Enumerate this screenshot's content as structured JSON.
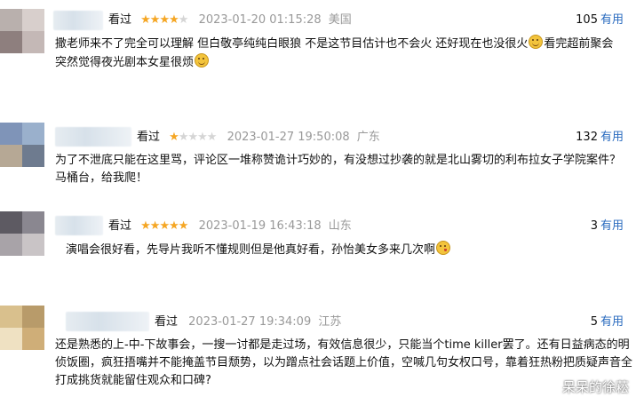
{
  "comments": [
    {
      "seen_label": "看过",
      "rating": 4,
      "time": "2023-01-20 01:15:28",
      "location": "美国",
      "votes": "105",
      "useful_label": "有用",
      "text_parts": [
        "撒老师来不了完全可以理解 但白敬亭纯纯白眼狼 不是这节目估计也不会火 还好现在也没很火",
        "看完超前聚会突然觉得夜光剧本女星很烦"
      ]
    },
    {
      "seen_label": "看过",
      "rating": 1,
      "time": "2023-01-27 19:50:08",
      "location": "广东",
      "votes": "132",
      "useful_label": "有用",
      "text": "为了不泄底只能在这里骂，评论区一堆称赞诡计巧妙的，有没想过抄袭的就是北山雾切的利布拉女子学院案件？马桶台，给我爬！"
    },
    {
      "seen_label": "看过",
      "rating": 5,
      "time": "2023-01-19 16:43:18",
      "location": "山东",
      "votes": "3",
      "useful_label": "有用",
      "text": "演唱会很好看，先导片我听不懂规则但是他真好看，孙怡美女多来几次啊"
    },
    {
      "seen_label": "看过",
      "rating": 0,
      "time": "2023-01-27 19:34:09",
      "location": "江苏",
      "votes": "5",
      "useful_label": "有用",
      "text": "还是熟悉的上-中-下故事会，一搜一讨都是走过场，有效信息很少，只能当个time killer罢了。还有日益病态的明侦饭圈，疯狂捂嘴并不能掩盖节目颓势，以为蹭点社会话题上价值，空喊几句女权口号，靠着狂热粉把质疑声音全打成挑货就能留住观众和口碑?"
    }
  ],
  "watermark": "呆呆的徐菘",
  "colors": {
    "star": "#f5a623",
    "useful": "#2a6bbf",
    "muted": "#999999"
  },
  "icons": [
    "smile-emoji-icon",
    "kiss-emoji-icon",
    "star-icon"
  ]
}
